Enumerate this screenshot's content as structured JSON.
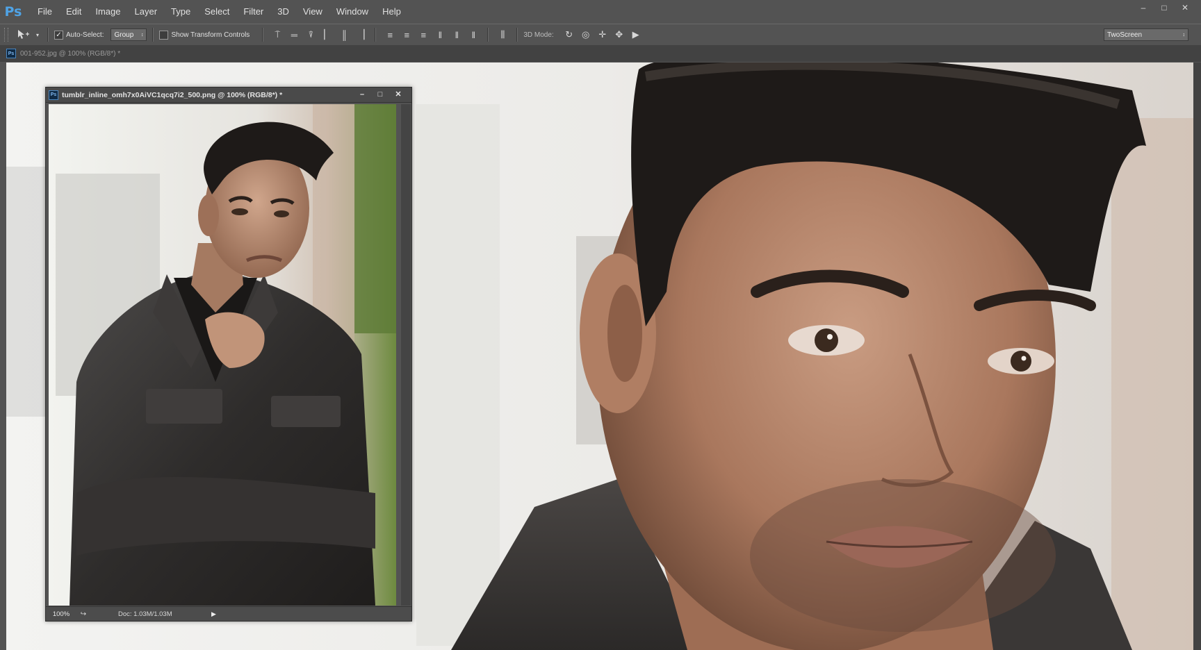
{
  "app": {
    "logo": "Ps",
    "menu": [
      "File",
      "Edit",
      "Image",
      "Layer",
      "Type",
      "Select",
      "Filter",
      "3D",
      "View",
      "Window",
      "Help"
    ],
    "window_controls": [
      "minimize-icon",
      "restore-icon",
      "close-icon"
    ]
  },
  "options_bar": {
    "auto_select_label": "Auto-Select:",
    "auto_select_checked": true,
    "auto_select_value": "Group",
    "transform_label": "Show Transform Controls",
    "transform_checked": false,
    "mode_3d_label": "3D Mode:",
    "workspace": "TwoScreen"
  },
  "document_tab": {
    "title": "001-952.jpg @ 100% (RGB/8*) *"
  },
  "floating_window": {
    "title": "tumblr_inline_omh7x0AiVC1qcq7i2_500.png @ 100% (RGB/8*) *",
    "zoom": "100%",
    "doc_size": "Doc: 1.03M/1.03M"
  },
  "colors": {
    "ui_bg": "#535353",
    "ps_blue": "#4fa3e6"
  }
}
